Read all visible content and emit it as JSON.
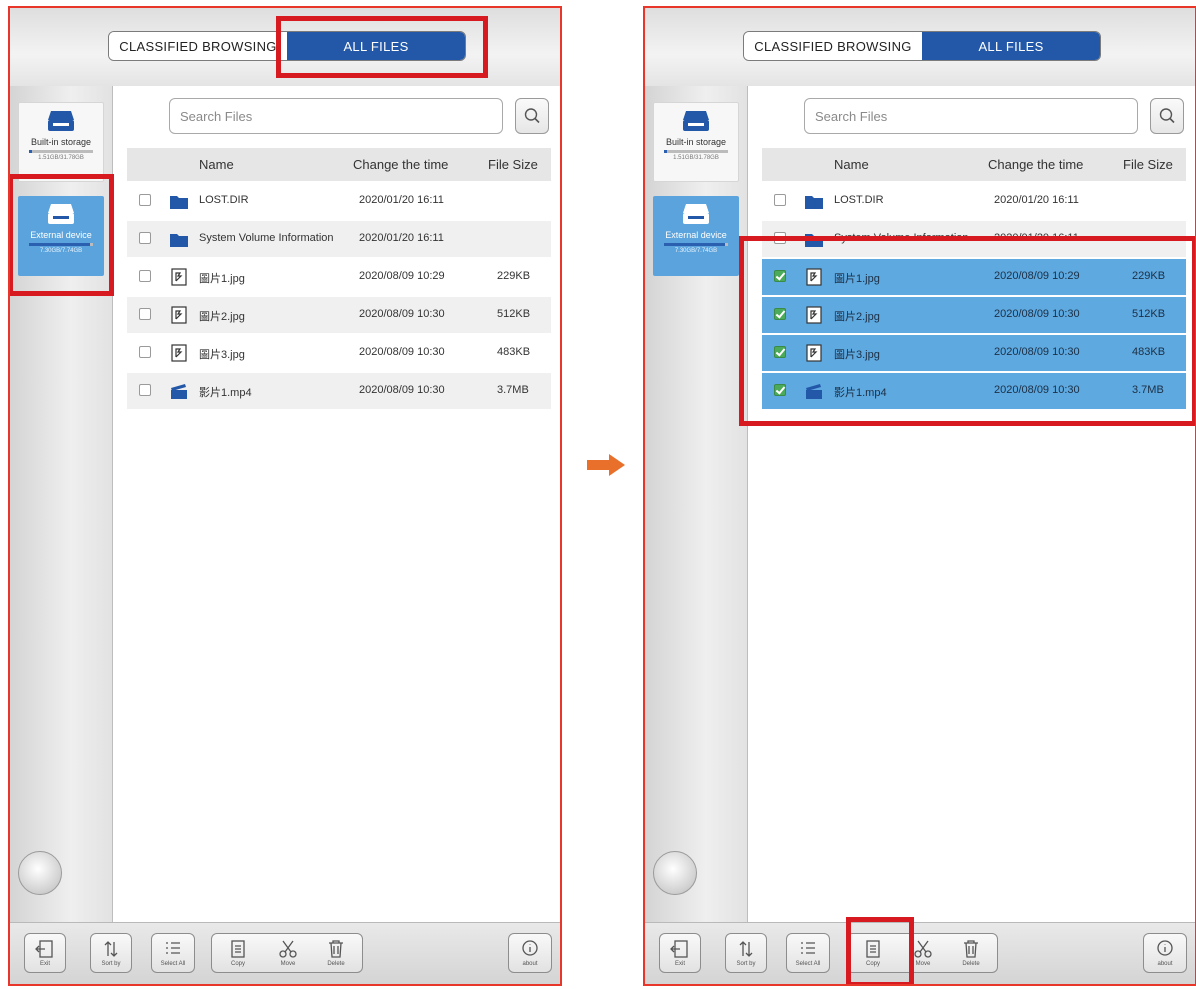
{
  "colors": {
    "accent": "#2358a8",
    "selected_row": "#5da9e0",
    "highlight": "#d71920",
    "panel_border": "#e8362b"
  },
  "panels": [
    {
      "segment": {
        "classified": "CLASSIFIED BROWSING",
        "all": "ALL FILES"
      },
      "devices": [
        {
          "label": "Built-in storage",
          "sub": "1.51GB/31.78GB",
          "used": 0.05
        },
        {
          "label": "External device",
          "sub": "7.30GB/7.74GB",
          "used": 0.95
        }
      ],
      "search": {
        "placeholder": "Search Files"
      },
      "table": {
        "headers": {
          "name": "Name",
          "time": "Change the time",
          "size": "File Size"
        },
        "rows": [
          {
            "name": "LOST.DIR",
            "time": "2020/01/20 16:11",
            "size": "",
            "icon": "folder-icon",
            "checked": false
          },
          {
            "name": "System Volume Information",
            "time": "2020/01/20 16:11",
            "size": "",
            "icon": "folder-icon",
            "checked": false
          },
          {
            "name": "圖片1.jpg",
            "time": "2020/08/09 10:29",
            "size": "229KB",
            "icon": "image-file-icon",
            "checked": false
          },
          {
            "name": "圖片2.jpg",
            "time": "2020/08/09 10:30",
            "size": "512KB",
            "icon": "image-file-icon",
            "checked": false
          },
          {
            "name": "圖片3.jpg",
            "time": "2020/08/09 10:30",
            "size": "483KB",
            "icon": "image-file-icon",
            "checked": false
          },
          {
            "name": "影片1.mp4",
            "time": "2020/08/09 10:30",
            "size": "3.7MB",
            "icon": "video-file-icon",
            "checked": false
          }
        ]
      },
      "toolbar": {
        "exit": "Exit",
        "sort": "Sort by",
        "select_all": "Select All",
        "copy": "Copy",
        "move": "Move",
        "delete": "Delete",
        "about": "about"
      }
    },
    {
      "segment": {
        "classified": "CLASSIFIED BROWSING",
        "all": "ALL FILES"
      },
      "devices": [
        {
          "label": "Built-in storage",
          "sub": "1.51GB/31.78GB",
          "used": 0.05
        },
        {
          "label": "External device",
          "sub": "7.30GB/7.74GB",
          "used": 0.95
        }
      ],
      "search": {
        "placeholder": "Search Files"
      },
      "table": {
        "headers": {
          "name": "Name",
          "time": "Change the time",
          "size": "File Size"
        },
        "rows": [
          {
            "name": "LOST.DIR",
            "time": "2020/01/20 16:11",
            "size": "",
            "icon": "folder-icon",
            "checked": false
          },
          {
            "name": "System Volume Information",
            "time": "2020/01/20 16:11",
            "size": "",
            "icon": "folder-icon",
            "checked": false
          },
          {
            "name": "圖片1.jpg",
            "time": "2020/08/09 10:29",
            "size": "229KB",
            "icon": "image-file-icon",
            "checked": true
          },
          {
            "name": "圖片2.jpg",
            "time": "2020/08/09 10:30",
            "size": "512KB",
            "icon": "image-file-icon",
            "checked": true
          },
          {
            "name": "圖片3.jpg",
            "time": "2020/08/09 10:30",
            "size": "483KB",
            "icon": "image-file-icon",
            "checked": true
          },
          {
            "name": "影片1.mp4",
            "time": "2020/08/09 10:30",
            "size": "3.7MB",
            "icon": "video-file-icon",
            "checked": true
          }
        ]
      },
      "toolbar": {
        "exit": "Exit",
        "sort": "Sort by",
        "select_all": "Select All",
        "copy": "Copy",
        "move": "Move",
        "delete": "Delete",
        "about": "about"
      }
    }
  ]
}
